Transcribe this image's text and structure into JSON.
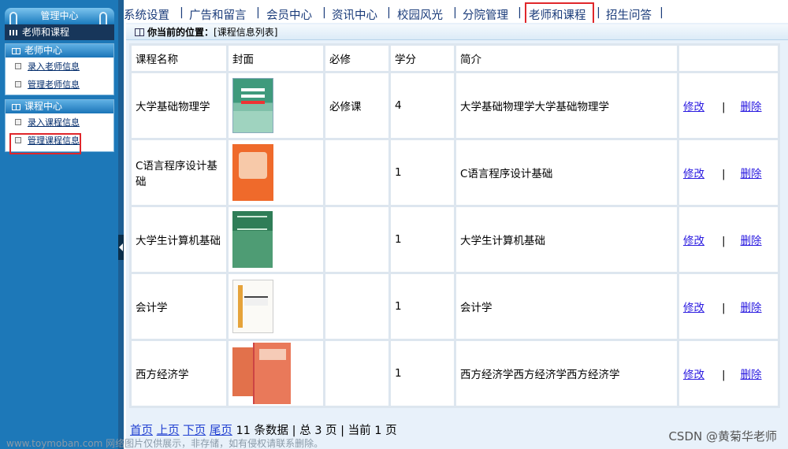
{
  "sidebar": {
    "header": "管理中心",
    "current_section": "老师和课程",
    "groups": [
      {
        "title": "老师中心",
        "items": [
          "录入老师信息",
          "管理老师信息"
        ]
      },
      {
        "title": "课程中心",
        "items": [
          "录入课程信息",
          "管理课程信息"
        ]
      }
    ]
  },
  "topnav": {
    "items": [
      "系统设置",
      "广告和留言",
      "会员中心",
      "资讯中心",
      "校园风光",
      "分院管理",
      "老师和课程",
      "招生问答"
    ],
    "separator": "|",
    "active": "老师和课程"
  },
  "breadcrumb": {
    "label": "你当前的位置：",
    "value": "[课程信息列表]"
  },
  "table": {
    "headers": [
      "课程名称",
      "封面",
      "必修",
      "学分",
      "简介",
      ""
    ],
    "rows": [
      {
        "name": "大学基础物理学",
        "cover": "book-cover-physics",
        "required": "必修课",
        "credit": "4",
        "intro": "大学基础物理学大学基础物理学",
        "edit": "修改",
        "sep": "|",
        "delete": "删除"
      },
      {
        "name": "C语言程序设计基础",
        "cover": "book-cover-c-language",
        "required": "",
        "credit": "1",
        "intro": "C语言程序设计基础",
        "edit": "修改",
        "sep": "|",
        "delete": "删除"
      },
      {
        "name": "大学生计算机基础",
        "cover": "book-cover-computer",
        "required": "",
        "credit": "1",
        "intro": "大学生计算机基础",
        "edit": "修改",
        "sep": "|",
        "delete": "删除"
      },
      {
        "name": "会计学",
        "cover": "book-cover-accounting",
        "required": "",
        "credit": "1",
        "intro": "会计学",
        "edit": "修改",
        "sep": "|",
        "delete": "删除"
      },
      {
        "name": "西方经济学",
        "cover": "book-cover-economics",
        "required": "",
        "credit": "1",
        "intro": "西方经济学西方经济学西方经济学",
        "edit": "修改",
        "sep": "|",
        "delete": "删除"
      }
    ]
  },
  "pager": {
    "first": "首页",
    "prev": "上页",
    "next": "下页",
    "last": "尾页",
    "total_records": "11 条数据",
    "total_pages": "| 总 3 页",
    "current_page": "| 当前 1 页"
  },
  "watermarks": {
    "left": "www.toymoban.com 网络图片仅供展示，非存储，如有侵权请联系删除。",
    "right": "CSDN @黄菊华老师"
  },
  "colors": {
    "sidebar_bg": "#1d78b8",
    "highlight_box": "#e0272b",
    "link": "#2a1ae0",
    "content_bg": "#e8f1fa"
  }
}
